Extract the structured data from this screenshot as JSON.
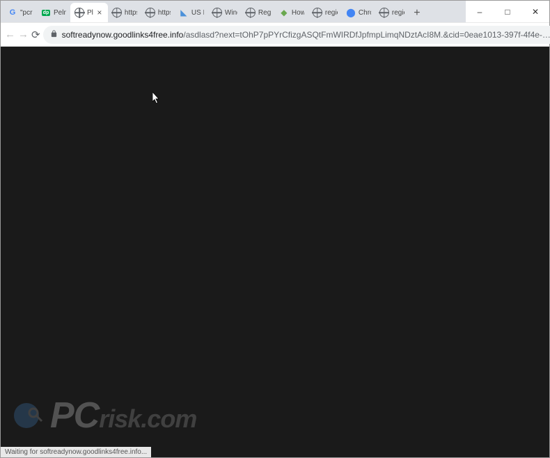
{
  "window": {
    "minimize": "–",
    "maximize": "□",
    "close": "✕"
  },
  "tabs": [
    {
      "title": "\"pcris",
      "favicon": "google"
    },
    {
      "title": "Pelny",
      "favicon": "dp"
    },
    {
      "title": "Pl",
      "favicon": "globe",
      "active": true
    },
    {
      "title": "https:",
      "favicon": "globe"
    },
    {
      "title": "https:",
      "favicon": "globe"
    },
    {
      "title": "US Fr",
      "favicon": "dot"
    },
    {
      "title": "Wind",
      "favicon": "globe"
    },
    {
      "title": "Regis",
      "favicon": "globe"
    },
    {
      "title": "How",
      "favicon": "diamond"
    },
    {
      "title": "regio",
      "favicon": "globe"
    },
    {
      "title": "Chro",
      "favicon": "chrome"
    },
    {
      "title": "regio",
      "favicon": "globe"
    }
  ],
  "new_tab": "+",
  "nav": {
    "back": "←",
    "forward": "→",
    "reload": "⟳"
  },
  "url": {
    "lock": "🔒",
    "domain": "softreadynow.goodlinks4free.info",
    "path": "/asdlasd?next=tOhP7pPYrCfizgASQtFmWIRDfJpfmpLimqNDztAcI8M.&cid=0eae1013-397f-4f4e-…",
    "star": "☆"
  },
  "account": "👤",
  "menu": "⋮",
  "status": "Waiting for softreadynow.goodlinks4free.info...",
  "watermark": {
    "main": "PC",
    "sub": "risk.com"
  }
}
